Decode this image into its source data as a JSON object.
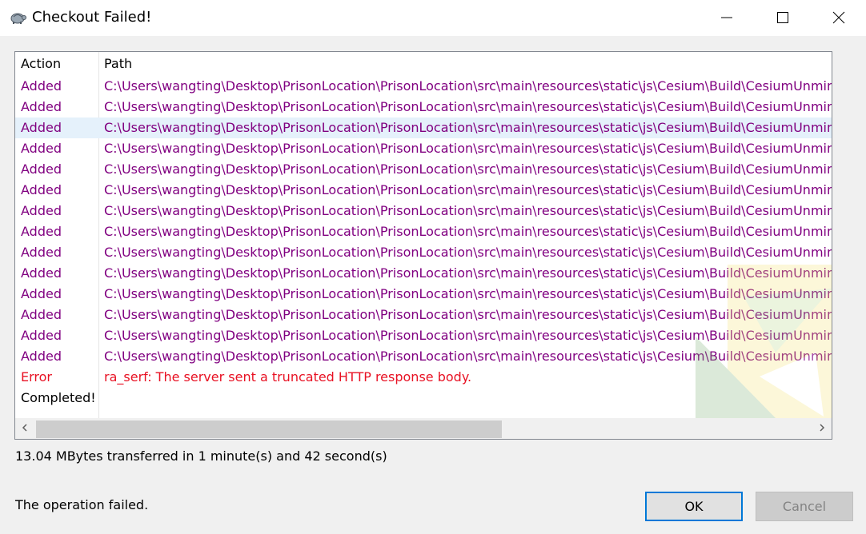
{
  "window": {
    "title": "Checkout Failed!",
    "app_icon": "tortoise-icon"
  },
  "list": {
    "columns": {
      "action": "Action",
      "path": "Path"
    },
    "rows": [
      {
        "action": "Added",
        "path": "C:\\Users\\wangting\\Desktop\\PrisonLocation\\PrisonLocation\\src\\main\\resources\\static\\js\\Cesium\\Build\\CesiumUnmini",
        "kind": "added"
      },
      {
        "action": "Added",
        "path": "C:\\Users\\wangting\\Desktop\\PrisonLocation\\PrisonLocation\\src\\main\\resources\\static\\js\\Cesium\\Build\\CesiumUnmini",
        "kind": "added"
      },
      {
        "action": "Added",
        "path": "C:\\Users\\wangting\\Desktop\\PrisonLocation\\PrisonLocation\\src\\main\\resources\\static\\js\\Cesium\\Build\\CesiumUnmini",
        "kind": "added",
        "selected": true
      },
      {
        "action": "Added",
        "path": "C:\\Users\\wangting\\Desktop\\PrisonLocation\\PrisonLocation\\src\\main\\resources\\static\\js\\Cesium\\Build\\CesiumUnmini",
        "kind": "added"
      },
      {
        "action": "Added",
        "path": "C:\\Users\\wangting\\Desktop\\PrisonLocation\\PrisonLocation\\src\\main\\resources\\static\\js\\Cesium\\Build\\CesiumUnmini",
        "kind": "added"
      },
      {
        "action": "Added",
        "path": "C:\\Users\\wangting\\Desktop\\PrisonLocation\\PrisonLocation\\src\\main\\resources\\static\\js\\Cesium\\Build\\CesiumUnmini",
        "kind": "added"
      },
      {
        "action": "Added",
        "path": "C:\\Users\\wangting\\Desktop\\PrisonLocation\\PrisonLocation\\src\\main\\resources\\static\\js\\Cesium\\Build\\CesiumUnmini",
        "kind": "added"
      },
      {
        "action": "Added",
        "path": "C:\\Users\\wangting\\Desktop\\PrisonLocation\\PrisonLocation\\src\\main\\resources\\static\\js\\Cesium\\Build\\CesiumUnmini",
        "kind": "added"
      },
      {
        "action": "Added",
        "path": "C:\\Users\\wangting\\Desktop\\PrisonLocation\\PrisonLocation\\src\\main\\resources\\static\\js\\Cesium\\Build\\CesiumUnmini",
        "kind": "added"
      },
      {
        "action": "Added",
        "path": "C:\\Users\\wangting\\Desktop\\PrisonLocation\\PrisonLocation\\src\\main\\resources\\static\\js\\Cesium\\Build\\CesiumUnmini",
        "kind": "added"
      },
      {
        "action": "Added",
        "path": "C:\\Users\\wangting\\Desktop\\PrisonLocation\\PrisonLocation\\src\\main\\resources\\static\\js\\Cesium\\Build\\CesiumUnmini",
        "kind": "added"
      },
      {
        "action": "Added",
        "path": "C:\\Users\\wangting\\Desktop\\PrisonLocation\\PrisonLocation\\src\\main\\resources\\static\\js\\Cesium\\Build\\CesiumUnmini",
        "kind": "added"
      },
      {
        "action": "Added",
        "path": "C:\\Users\\wangting\\Desktop\\PrisonLocation\\PrisonLocation\\src\\main\\resources\\static\\js\\Cesium\\Build\\CesiumUnmini",
        "kind": "added"
      },
      {
        "action": "Added",
        "path": "C:\\Users\\wangting\\Desktop\\PrisonLocation\\PrisonLocation\\src\\main\\resources\\static\\js\\Cesium\\Build\\CesiumUnmini",
        "kind": "added"
      },
      {
        "action": "Error",
        "path": "ra_serf: The server sent a truncated HTTP response body.",
        "kind": "error"
      },
      {
        "action": "Completed!",
        "path": "",
        "kind": "completed"
      }
    ]
  },
  "transfer_info": "13.04 MBytes transferred in 1 minute(s) and 42 second(s)",
  "status_text": "The operation failed.",
  "buttons": {
    "ok": "OK",
    "cancel": "Cancel",
    "cancel_enabled": false
  },
  "colors": {
    "added": "#800080",
    "error": "#e81123",
    "selection": "#e5f1fb",
    "focus_border": "#0078d7"
  }
}
